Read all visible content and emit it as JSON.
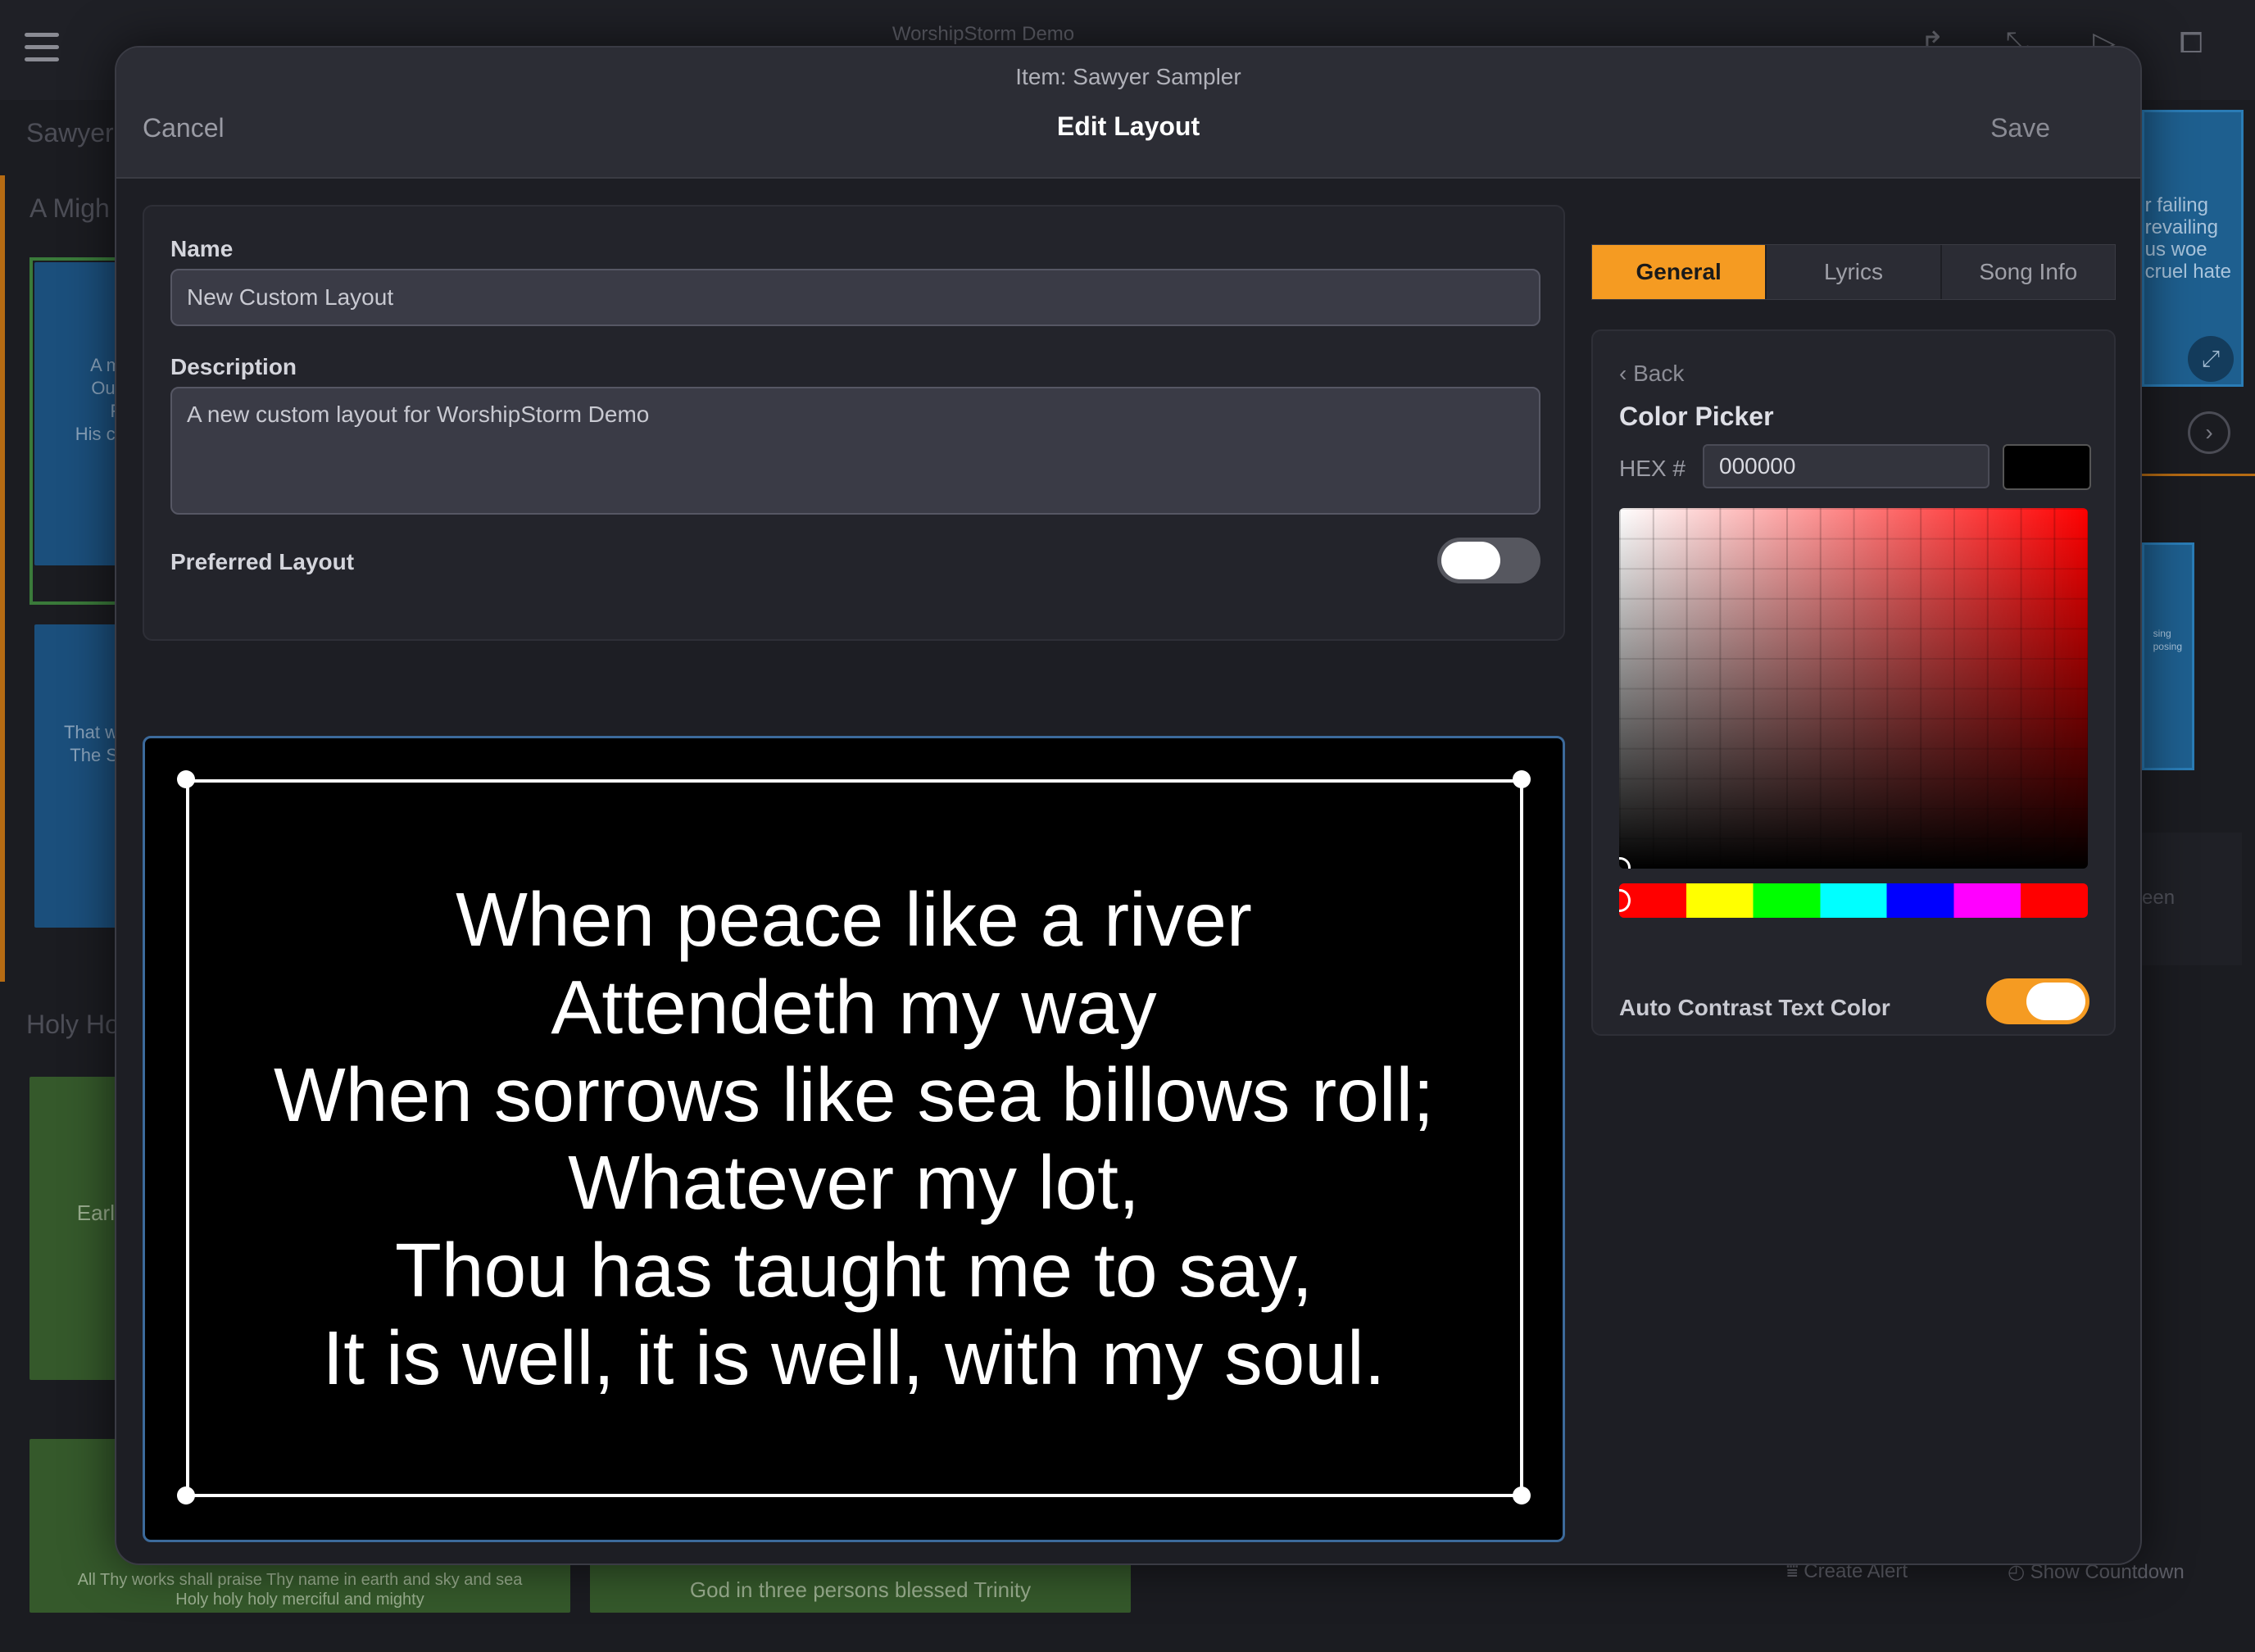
{
  "app": {
    "title": "WorshipStorm Demo"
  },
  "background": {
    "sections": [
      {
        "title": "Sawyer",
        "slides": [
          {
            "lines": [
              "A m",
              "Our",
              "F",
              "His cr"
            ]
          },
          {
            "lines": [
              "That w",
              "The S"
            ]
          }
        ]
      },
      {
        "title": "A Migh"
      },
      {
        "title": "Holy Ho",
        "slides": [
          {
            "lines": [
              "Earl"
            ]
          },
          {
            "lines": [
              "All Thy works shall praise Thy name in earth and sky and sea",
              "Holy holy holy merciful and mighty"
            ]
          },
          {
            "lines": [
              "God in three persons blessed Trinity"
            ]
          }
        ]
      }
    ],
    "right_preview_lines": [
      "r failing",
      "revailing",
      "us woe",
      "cruel hate"
    ],
    "right_preview2_lines": [
      "sing",
      "posing"
    ],
    "right_screen_label": "een",
    "bottom_actions": {
      "create_alert": "Create Alert",
      "show_countdown": "Show Countdown"
    }
  },
  "modal": {
    "subtitle": "Item: Sawyer Sampler",
    "title": "Edit Layout",
    "cancel": "Cancel",
    "save": "Save",
    "form": {
      "name_label": "Name",
      "name_value": "New Custom Layout",
      "description_label": "Description",
      "description_value": "A new custom layout for WorshipStorm Demo",
      "preferred_label": "Preferred Layout",
      "preferred_on": false
    },
    "preview": {
      "lines": [
        "When peace like a river",
        "Attendeth my way",
        "When sorrows like sea billows roll;",
        "Whatever my lot,",
        "Thou has taught me to say,",
        "It is well, it is well, with my soul."
      ],
      "background_color": "#000000",
      "text_color": "#ffffff"
    },
    "tabs": [
      {
        "label": "General",
        "active": true
      },
      {
        "label": "Lyrics",
        "active": false
      },
      {
        "label": "Song Info",
        "active": false
      }
    ],
    "color_picker": {
      "back": "‹ Back",
      "title": "Color Picker",
      "hex_label": "HEX #",
      "hex_value": "000000",
      "current_color": "#000000",
      "auto_contrast_label": "Auto Contrast Text Color",
      "auto_contrast_on": true
    }
  },
  "colors": {
    "accent": "#f59b22",
    "preview_border": "#3c6a9b"
  }
}
